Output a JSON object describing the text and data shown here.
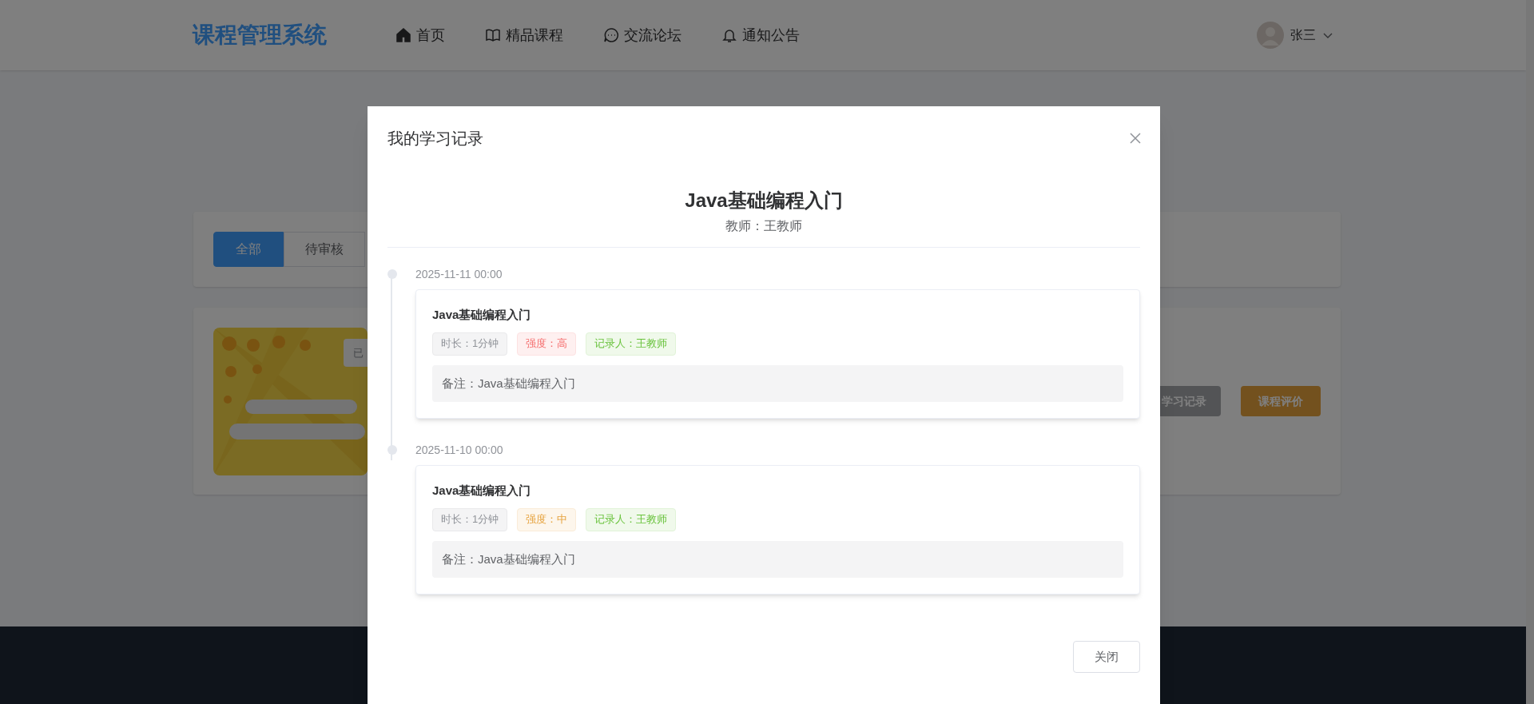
{
  "header": {
    "logo": "课程管理系统",
    "nav": [
      {
        "label": "首页",
        "kind": "home"
      },
      {
        "label": "精品课程",
        "kind": "book"
      },
      {
        "label": "交流论坛",
        "kind": "chat"
      },
      {
        "label": "通知公告",
        "kind": "bell"
      }
    ],
    "user": {
      "name": "张三"
    }
  },
  "filter_tabs": [
    {
      "label": "全部",
      "selected": true
    },
    {
      "label": "待审核",
      "selected": false
    }
  ],
  "course_card": {
    "badge": "已",
    "buttons": [
      {
        "label": "学习记录",
        "kind": "secondary"
      },
      {
        "label": "课程评价",
        "kind": "warning"
      }
    ]
  },
  "dialog": {
    "title": "我的学习记录",
    "course_title": "Java基础编程入门",
    "teacher": "教师：王教师",
    "records": [
      {
        "time": "2025-11-11 00:00",
        "title": "Java基础编程入门",
        "tags": [
          {
            "text": "时长：1分钟",
            "kind": "info"
          },
          {
            "text": "强度：高",
            "kind": "danger"
          },
          {
            "text": "记录人：王教师",
            "kind": "success"
          }
        ],
        "note": "备注：Java基础编程入门"
      },
      {
        "time": "2025-11-10 00:00",
        "title": "Java基础编程入门",
        "tags": [
          {
            "text": "时长：1分钟",
            "kind": "info"
          },
          {
            "text": "强度：中",
            "kind": "warning"
          },
          {
            "text": "记录人：王教师",
            "kind": "success"
          }
        ],
        "note": "备注：Java基础编程入门"
      }
    ],
    "buttons": [
      "关闭"
    ]
  }
}
